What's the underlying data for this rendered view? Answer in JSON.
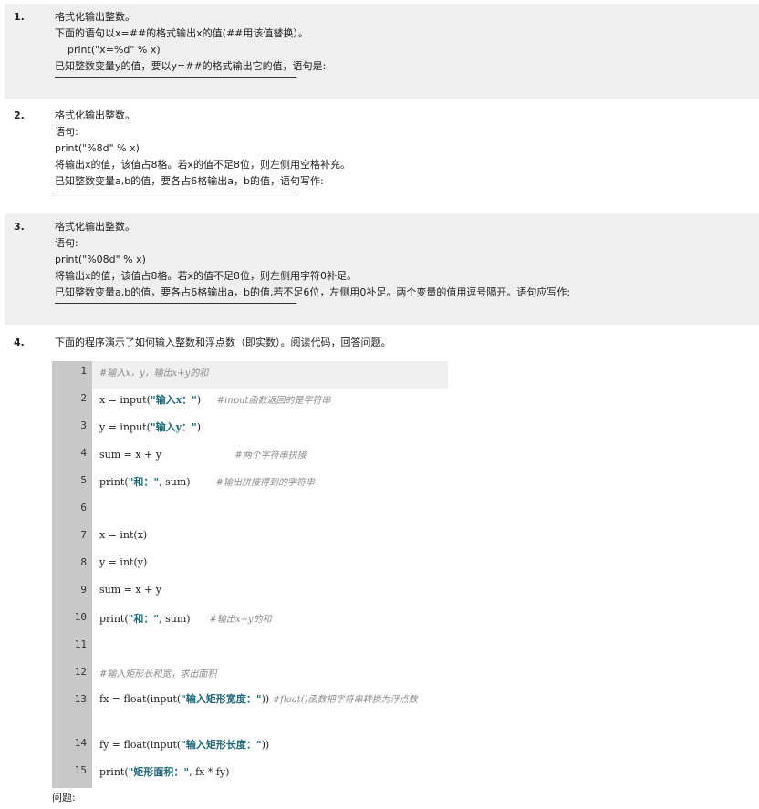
{
  "questions": [
    {
      "number": "1.",
      "lines": [
        "格式化输出整数。",
        "下面的语句以x=##的格式输出x的值(##用该值替换）。",
        "    print(\"x=%d\" % x)",
        "已知整数变量y的值，要以y=##的格式输出它的值，语句是:"
      ]
    },
    {
      "number": "2.",
      "lines": [
        "格式化输出整数。",
        "语句:",
        "print(\"%8d\" % x)",
        "将输出x的值，该值占8格。若x的值不足8位，则左侧用空格补充。",
        "已知整数变量a,b的值，要各占6格输出a，b的值，语句写作:"
      ]
    },
    {
      "number": "3.",
      "lines": [
        "格式化输出整数。",
        "语句:",
        "print(\"%08d\" % x)",
        "将输出x的值，该值占8格。若x的值不足8位，则左侧用字符0补足。",
        "已知整数变量a,b的值，要各占6格输出a，b的值,若不足6位，左侧用0补足。两个变量的值用逗号隔开。语句应写作:"
      ]
    },
    {
      "number": "4.",
      "intro": "下面的程序演示了如何输入整数和浮点数（即实数）。阅读代码，回答问题。"
    }
  ],
  "code": [
    {
      "n": "1",
      "code": "",
      "str": "",
      "post": "",
      "comment": "#输入x，y，输出x+y的和"
    },
    {
      "n": "2",
      "code": "x = input(",
      "str": "\"输入x：\"",
      "post": ")     ",
      "comment": "#input函数返回的是字符串"
    },
    {
      "n": "3",
      "code": "y = input(",
      "str": "\"输入y：\"",
      "post": ")",
      "comment": ""
    },
    {
      "n": "4",
      "code": "sum = x + y                       ",
      "str": "",
      "post": "",
      "comment": "#两个字符串拼接"
    },
    {
      "n": "5",
      "code": "print(",
      "str": "\"和：\"",
      "post": ", sum)        ",
      "comment": "#输出拼接得到的字符串"
    },
    {
      "n": "6",
      "code": "",
      "str": "",
      "post": "",
      "comment": ""
    },
    {
      "n": "7",
      "code": "x = int(x)",
      "str": "",
      "post": "",
      "comment": ""
    },
    {
      "n": "8",
      "code": "y = int(y)",
      "str": "",
      "post": "",
      "comment": ""
    },
    {
      "n": "9",
      "code": "sum = x + y",
      "str": "",
      "post": "",
      "comment": ""
    },
    {
      "n": "10",
      "code": "print(",
      "str": "\"和：\"",
      "post": ", sum)      ",
      "comment": "#输出x+y的和"
    },
    {
      "n": "11",
      "code": "",
      "str": "",
      "post": "",
      "comment": ""
    },
    {
      "n": "12",
      "code": "",
      "str": "",
      "post": "",
      "comment": "#输入矩形长和宽，求出面积"
    },
    {
      "n": "13",
      "code": "fx = float(input(",
      "str": "\"输入矩形宽度：\"",
      "post": "))   ",
      "comment": "#float()函数把字符串转换为浮点数"
    },
    {
      "n": "14",
      "code": "fy = float(input(",
      "str": "\"输入矩形长度：\"",
      "post": "))",
      "comment": ""
    },
    {
      "n": "15",
      "code": "print(",
      "str": "\"矩形面积：\"",
      "post": ", fx * fy)",
      "comment": ""
    }
  ],
  "question_label": "问题:"
}
